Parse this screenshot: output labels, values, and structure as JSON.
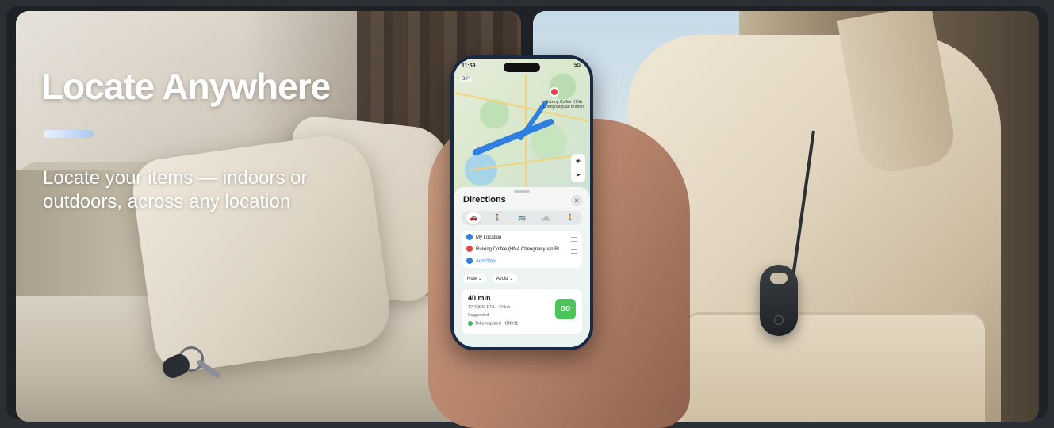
{
  "banner": {
    "headline": "Locate Anywhere",
    "subline": "Locate your items — indoors or outdoors, across any location"
  },
  "phone": {
    "status_time": "11:59",
    "status_icons": "5G",
    "temperature": "30°",
    "pin_label": "Ruixing Coffee (HNA Chengnanyuan Branch)",
    "sheet_title": "Directions",
    "close_icon": "×",
    "modes": [
      {
        "icon": "car-icon",
        "glyph": "🚗",
        "active": true
      },
      {
        "icon": "walk-icon",
        "glyph": "🚶",
        "active": false
      },
      {
        "icon": "transit-icon",
        "glyph": "🚌",
        "active": false
      },
      {
        "icon": "bike-icon",
        "glyph": "🚲",
        "active": false
      },
      {
        "icon": "rideshare-icon",
        "glyph": "🚶",
        "active": false
      }
    ],
    "stops": {
      "from": "My Location",
      "to": "Ruixing Coffee (HNA Chengnanyuan Br...",
      "add": "Add Stop"
    },
    "chips": {
      "time": "Now",
      "avoid": "Avoid"
    },
    "route": {
      "duration": "40 min",
      "eta": "12:39PM ETA · 30 km",
      "tag": "Suggested",
      "tolls": "Tolls required · CN¥11",
      "go_label": "GO"
    }
  },
  "colors": {
    "accent": "#2f7fe0",
    "go": "#4cc45a",
    "pin": "#e2464b"
  }
}
